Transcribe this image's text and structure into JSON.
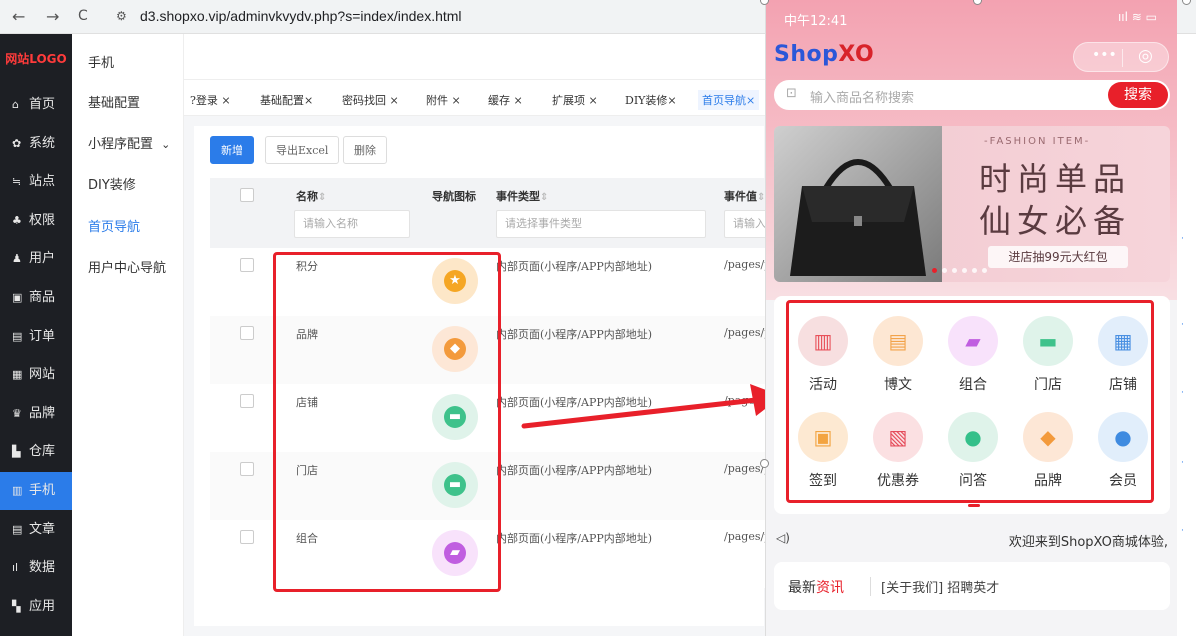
{
  "browser": {
    "url": "d3.shopxo.vip/adminvkvydv.php?s=index/index.html",
    "back": "←",
    "forward": "→",
    "reload": "C"
  },
  "sidebar": {
    "logo": "网站LOGO",
    "items": [
      {
        "icon": "home-icon",
        "glyph": "⌂",
        "label": "首页"
      },
      {
        "icon": "gear-icon",
        "glyph": "✿",
        "label": "系统"
      },
      {
        "icon": "sliders-icon",
        "glyph": "≒",
        "label": "站点"
      },
      {
        "icon": "user-lock-icon",
        "glyph": "♣",
        "label": "权限"
      },
      {
        "icon": "user-icon",
        "glyph": "♟",
        "label": "用户"
      },
      {
        "icon": "box-icon",
        "glyph": "▣",
        "label": "商品"
      },
      {
        "icon": "order-icon",
        "glyph": "▤",
        "label": "订单"
      },
      {
        "icon": "monitor-icon",
        "glyph": "▦",
        "label": "网站"
      },
      {
        "icon": "brand-icon",
        "glyph": "♛",
        "label": "品牌"
      },
      {
        "icon": "warehouse-icon",
        "glyph": "▙",
        "label": "仓库"
      },
      {
        "icon": "phone-icon",
        "glyph": "▥",
        "label": "手机"
      },
      {
        "icon": "article-icon",
        "glyph": "▤",
        "label": "文章"
      },
      {
        "icon": "chart-icon",
        "glyph": "ıl",
        "label": "数据"
      },
      {
        "icon": "apps-icon",
        "glyph": "▚",
        "label": "应用"
      }
    ],
    "active_index": 10
  },
  "submenu": {
    "title": "手机",
    "items": [
      "基础配置",
      "小程序配置",
      "DIY装修",
      "首页导航",
      "用户中心导航"
    ],
    "expand_glyph": "⌄",
    "active_index": 3
  },
  "tabs": [
    {
      "label": "?登录 ×"
    },
    {
      "label": "基础配置×"
    },
    {
      "label": "密码找回 ×"
    },
    {
      "label": "附件 ×"
    },
    {
      "label": "缓存 ×"
    },
    {
      "label": "扩展项 ×"
    },
    {
      "label": "DIY装修×"
    },
    {
      "label": "首页导航×"
    }
  ],
  "toolbar": {
    "add_label": "新增",
    "export_label": "导出Excel",
    "delete_label": "删除"
  },
  "table": {
    "headers": {
      "name": "名称",
      "icon": "导航图标",
      "event_type": "事件类型",
      "event_value": "事件值"
    },
    "sort_glyph": "⇕",
    "filters": {
      "name_placeholder": "请输入名称",
      "event_type_placeholder": "请选择事件类型",
      "event_value_placeholder": "请输入"
    },
    "rows": [
      {
        "name": "积分",
        "icon": "points-icon",
        "event_type": "内部页面(小程序/APP内部地址)",
        "event_value": "/pages/plu"
      },
      {
        "name": "品牌",
        "icon": "diamond-icon",
        "event_type": "内部页面(小程序/APP内部地址)",
        "event_value": "/pages/plu"
      },
      {
        "name": "店铺",
        "icon": "store-icon",
        "event_type": "内部页面(小程序/APP内部地址)",
        "event_value": "/pages/plu"
      },
      {
        "name": "门店",
        "icon": "store-icon",
        "event_type": "内部页面(小程序/APP内部地址)",
        "event_value": "/pages/plu"
      },
      {
        "name": "组合",
        "icon": "combo-icon",
        "event_type": "内部页面(小程序/APP内部地址)",
        "event_value": "/pages/plu"
      }
    ]
  },
  "phone": {
    "status_time": "中午12:41",
    "status_right": "ııl ≋ ▭",
    "brand_a": "Shop",
    "brand_b": "XO",
    "capsule_dots": "•••",
    "capsule_target": "◎",
    "search_placeholder": "输入商品名称搜索",
    "search_button": "搜索",
    "scan_glyph": "⊡",
    "banner": {
      "small": "-FASHION ITEM-",
      "line1": "时尚单品",
      "line2": "仙女必备",
      "button": "进店抽99元大红包"
    },
    "nav": [
      {
        "label": "活动",
        "icon": "gift-icon",
        "color": "#f7dfe0",
        "fg": "#e8515a"
      },
      {
        "label": "博文",
        "icon": "doc-icon",
        "color": "#fde7d3",
        "fg": "#f2a34a"
      },
      {
        "label": "组合",
        "icon": "combo-icon",
        "color": "#f8e2fb",
        "fg": "#c05ee0"
      },
      {
        "label": "门店",
        "icon": "store-icon",
        "color": "#dff3ea",
        "fg": "#3ec28b"
      },
      {
        "label": "店铺",
        "icon": "shop-icon",
        "color": "#e2eefb",
        "fg": "#4a90e2"
      },
      {
        "label": "签到",
        "icon": "calendar-icon",
        "color": "#fde9d2",
        "fg": "#f3a441"
      },
      {
        "label": "优惠券",
        "icon": "coupon-icon",
        "color": "#fbe0e2",
        "fg": "#e54b5a"
      },
      {
        "label": "问答",
        "icon": "bulb-icon",
        "color": "#dff3ea",
        "fg": "#34c08a"
      },
      {
        "label": "品牌",
        "icon": "diamond-icon",
        "color": "#fde7d6",
        "fg": "#f39a3c"
      },
      {
        "label": "会员",
        "icon": "member-icon",
        "color": "#e1eefb",
        "fg": "#3f8be0"
      }
    ],
    "notice_icon": "◁)",
    "notice": "欢迎来到ShopXO商城体验,",
    "news_title_a": "最新",
    "news_title_b": "资讯",
    "news_text": "[关于我们] 招聘英才"
  },
  "colors": {
    "accent": "#2b7ce9",
    "highlight": "#e8202a",
    "sidebar_bg": "#1d1f24"
  }
}
